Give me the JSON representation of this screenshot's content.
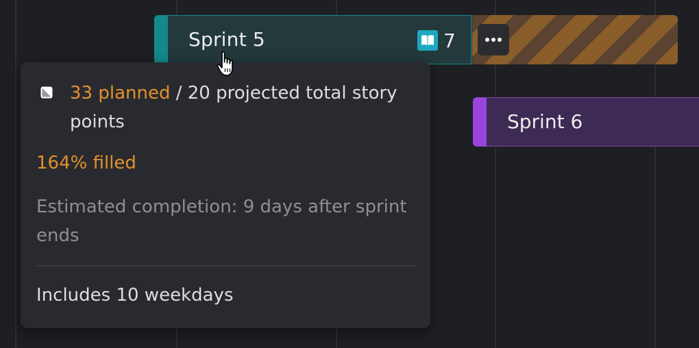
{
  "timeline": {
    "sprint5": {
      "name": "Sprint 5",
      "story_count": "7",
      "accent_color": "#13898a",
      "overflow_color": "#8a5e2a",
      "count_icon": "book-open-icon"
    },
    "more_button": {
      "icon": "more-horizontal-icon"
    },
    "sprint6": {
      "name": "Sprint 6",
      "accent_color": "#9845dd"
    }
  },
  "tooltip": {
    "status_icon": "half-filled-square-icon",
    "planned": "33 planned",
    "projected": " / 20 projected total story points",
    "filled": "164% filled",
    "estimate": "Estimated completion: 9 days after sprint ends",
    "weekdays": "Includes 10 weekdays",
    "warning_color": "#e1922c"
  },
  "cursor": {
    "icon": "pointer-hand-icon"
  }
}
